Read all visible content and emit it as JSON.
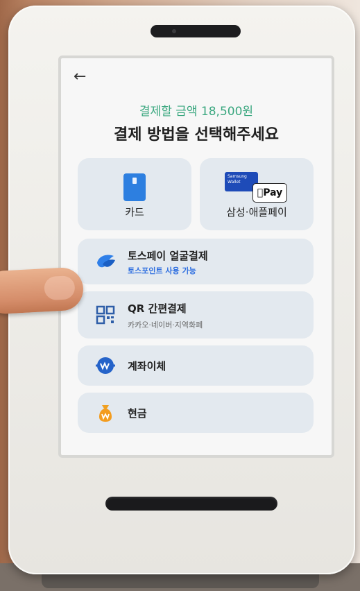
{
  "screen": {
    "back_icon": "arrow-left-icon",
    "amount_text": "결제할 금액 18,500원",
    "title": "결제 방법을 선택해주세요"
  },
  "tiles": {
    "card": {
      "label": "카드",
      "icon": "credit-card-icon"
    },
    "samsung_apple": {
      "label": "삼성·애플페이",
      "samsung_badge": "Samsung Wallet",
      "apple_badge": "Pay"
    }
  },
  "rows": [
    {
      "title": "토스페이 얼굴결제",
      "sub": "토스포인트 사용 가능",
      "icon": "toss-icon"
    },
    {
      "title": "QR 간편결제",
      "sub": "카카오·네이버·지역화폐",
      "icon": "qr-code-icon"
    },
    {
      "title": "계좌이체",
      "icon": "won-transfer-icon"
    },
    {
      "title": "현금",
      "icon": "money-bag-icon"
    }
  ],
  "colors": {
    "accent_green": "#3aa77f",
    "sub_blue": "#2f6fe0",
    "tile_bg": "#e3e9ef",
    "card_blue": "#2d7fe0"
  }
}
